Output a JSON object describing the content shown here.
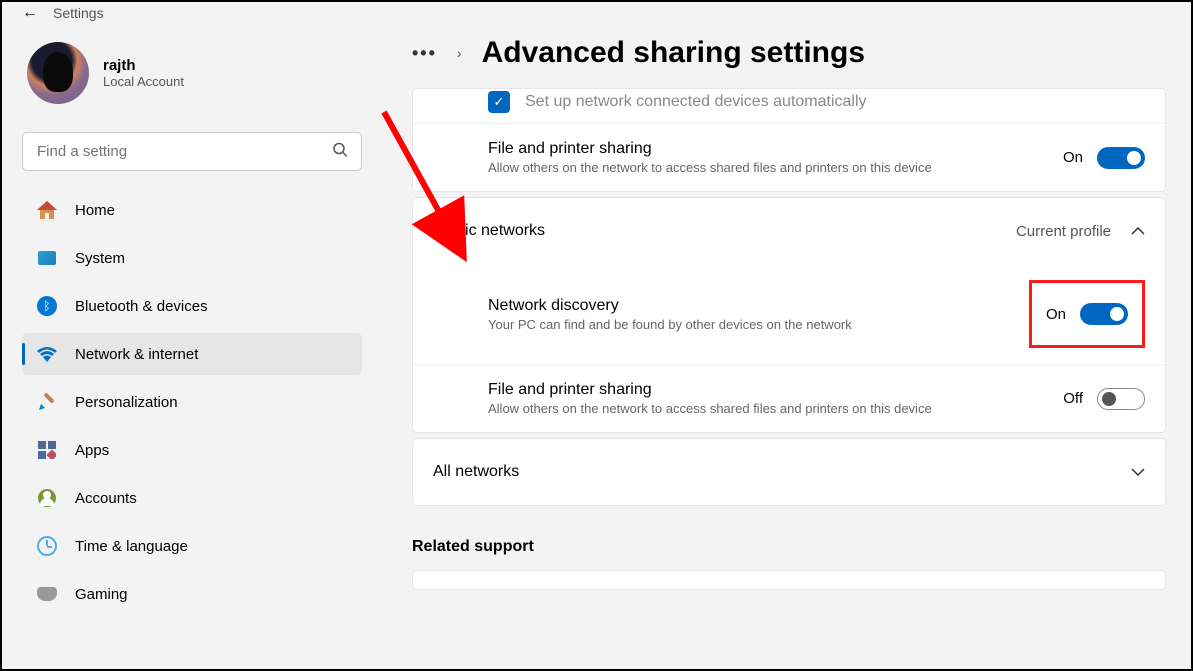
{
  "topbar": {
    "title": "Settings"
  },
  "profile": {
    "username": "rajth",
    "account_type": "Local Account"
  },
  "search": {
    "placeholder": "Find a setting"
  },
  "nav": [
    {
      "label": "Home",
      "icon": "home"
    },
    {
      "label": "System",
      "icon": "system"
    },
    {
      "label": "Bluetooth & devices",
      "icon": "bluetooth"
    },
    {
      "label": "Network & internet",
      "icon": "wifi",
      "active": true
    },
    {
      "label": "Personalization",
      "icon": "brush"
    },
    {
      "label": "Apps",
      "icon": "apps"
    },
    {
      "label": "Accounts",
      "icon": "account"
    },
    {
      "label": "Time & language",
      "icon": "time"
    },
    {
      "label": "Gaming",
      "icon": "gaming"
    }
  ],
  "header": {
    "breadcrumb_dots": "•••",
    "breadcrumb_chevron": "›",
    "page_title": "Advanced sharing settings"
  },
  "private_section": {
    "auto_setup_label": "Set up network connected devices automatically",
    "file_printer": {
      "title": "File and printer sharing",
      "desc": "Allow others on the network to access shared files and printers on this device",
      "state_label": "On",
      "state": true
    }
  },
  "public_section": {
    "title": "Public networks",
    "current_profile": "Current profile",
    "network_discovery": {
      "title": "Network discovery",
      "desc": "Your PC can find and be found by other devices on the network",
      "state_label": "On",
      "state": true
    },
    "file_printer": {
      "title": "File and printer sharing",
      "desc": "Allow others on the network to access shared files and printers on this device",
      "state_label": "Off",
      "state": false
    }
  },
  "all_networks": {
    "title": "All networks"
  },
  "related": {
    "title": "Related support"
  }
}
